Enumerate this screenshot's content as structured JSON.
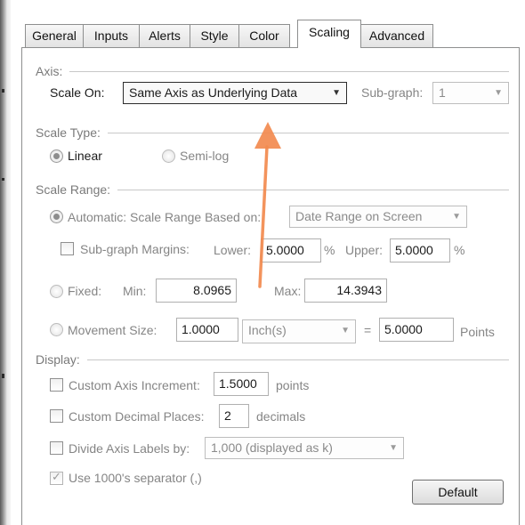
{
  "tabs": [
    "General",
    "Inputs",
    "Alerts",
    "Style",
    "Color",
    "Scaling",
    "Advanced"
  ],
  "axis": {
    "group_label": "Axis:",
    "scale_on_label": "Scale On:",
    "scale_on_value": "Same Axis as Underlying Data",
    "subgraph_label": "Sub-graph:",
    "subgraph_value": "1"
  },
  "scale_type": {
    "group_label": "Scale Type:",
    "linear": "Linear",
    "semilog": "Semi-log",
    "selected": "Linear"
  },
  "scale_range": {
    "group_label": "Scale Range:",
    "automatic_label": "Automatic: Scale Range Based on:",
    "automatic_value": "Date Range on Screen",
    "subgraph_margins_label": "Sub-graph Margins:",
    "lower_label": "Lower:",
    "lower_value": "5.0000",
    "upper_label": "Upper:",
    "upper_value": "5.0000",
    "percent": "%",
    "fixed_label": "Fixed:",
    "min_label": "Min:",
    "min_value": "8.0965",
    "max_label": "Max:",
    "max_value": "14.3943",
    "movement_label": "Movement Size:",
    "movement_value": "1.0000",
    "movement_unit": "Inch(s)",
    "equals": "=",
    "points_value": "5.0000",
    "points_label": "Points"
  },
  "display": {
    "group_label": "Display:",
    "custom_increment_label": "Custom Axis Increment:",
    "custom_increment_value": "1.5000",
    "custom_increment_unit": "points",
    "custom_decimal_label": "Custom Decimal Places:",
    "custom_decimal_value": "2",
    "custom_decimal_unit": "decimals",
    "divide_label": "Divide Axis Labels by:",
    "divide_value": "1,000 (displayed as k)",
    "separator_label": "Use 1000's separator (,)",
    "separator_checked": true
  },
  "default_button": "Default",
  "colors": {
    "annotation_arrow": "#f28a4f",
    "frame": "#8e8f8f",
    "muted_text": "#858585"
  }
}
